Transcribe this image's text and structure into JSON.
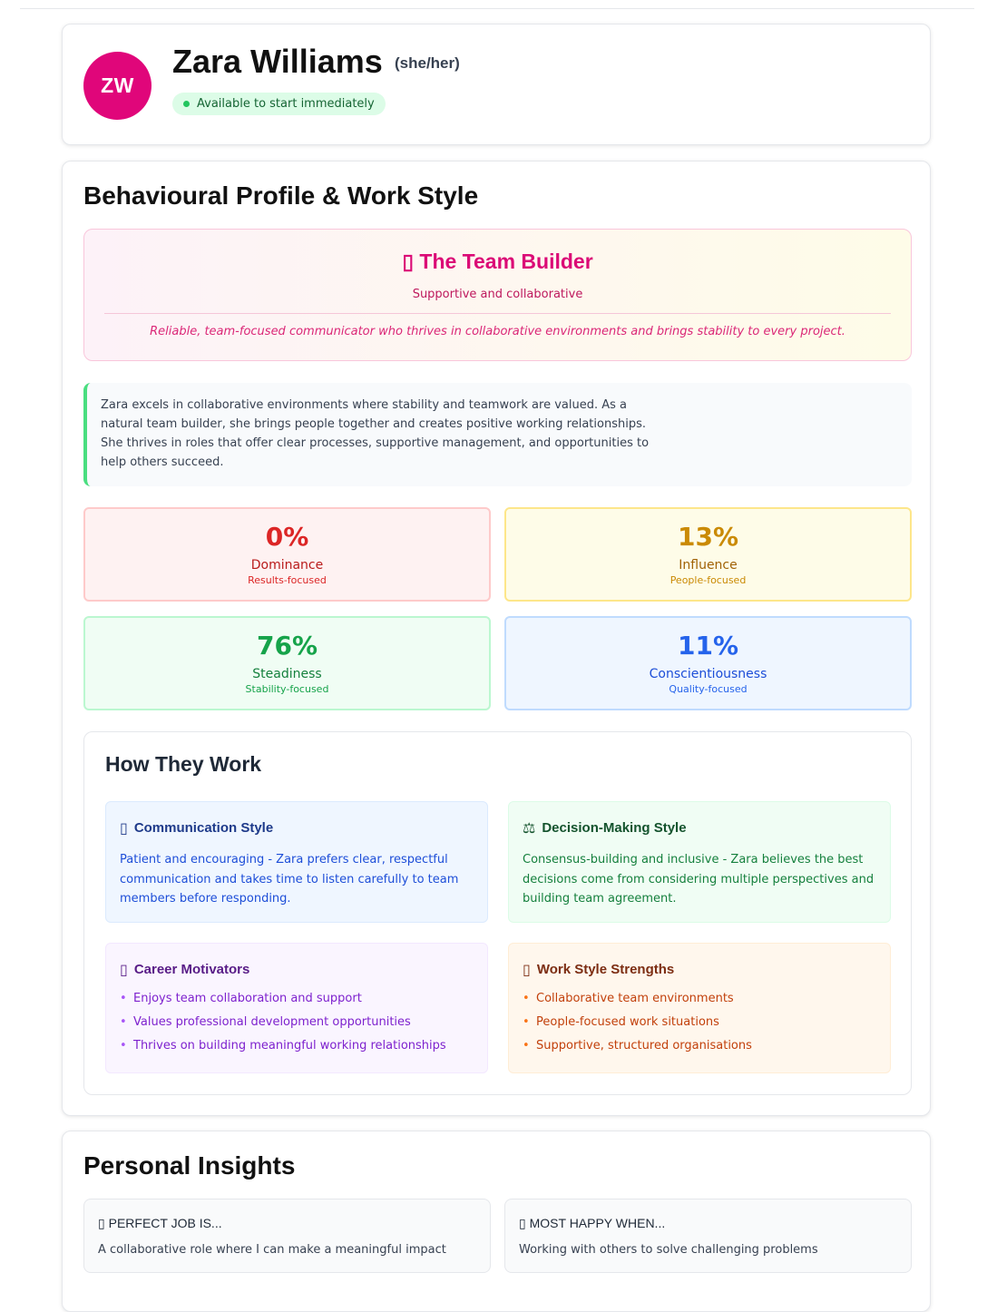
{
  "header": {
    "initials": "ZW",
    "name": "Zara Williams",
    "pronouns": "(she/her)",
    "availability": "Available to start immediately"
  },
  "behaviour": {
    "title": "Behavioural Profile & Work Style",
    "type": {
      "icon": "missing-glyph-icon",
      "icon_glyph": "▯",
      "title": "The Team Builder",
      "subtitle": "Supportive and collaborative",
      "description": "Reliable, team-focused communicator who thrives in collaborative environments and brings stability to every project."
    },
    "summary": "Zara excels in collaborative environments where stability and teamwork are valued. As a natural team builder, she brings people together and creates positive working relationships. She thrives in roles that offer clear processes, supportive management, and opportunities to help others succeed.",
    "disc": [
      {
        "percent": "0%",
        "label": "Dominance",
        "sub": "Results-focused",
        "color": "#dc2626"
      },
      {
        "percent": "13%",
        "label": "Influence",
        "sub": "People-focused",
        "color": "#ca8a04"
      },
      {
        "percent": "76%",
        "label": "Steadiness",
        "sub": "Stability-focused",
        "color": "#16a34a"
      },
      {
        "percent": "11%",
        "label": "Conscientiousness",
        "sub": "Quality-focused",
        "color": "#2563eb"
      }
    ],
    "how_they_work": {
      "title": "How They Work",
      "communication": {
        "icon": "missing-glyph-icon",
        "glyph": "▯",
        "title": "Communication Style",
        "text": "Patient and encouraging - Zara prefers clear, respectful communication and takes time to listen carefully to team members before responding."
      },
      "decision": {
        "icon": "scales-icon",
        "glyph": "⚖",
        "title": "Decision-Making Style",
        "text": "Consensus-building and inclusive - Zara believes the best decisions come from considering multiple perspectives and building team agreement."
      },
      "motivators": {
        "icon": "missing-glyph-icon",
        "glyph": "▯",
        "title": "Career Motivators",
        "items": [
          "Enjoys team collaboration and support",
          "Values professional development opportunities",
          "Thrives on building meaningful working relationships"
        ]
      },
      "strengths": {
        "icon": "missing-glyph-icon",
        "glyph": "▯",
        "title": "Work Style Strengths",
        "items": [
          "Collaborative team environments",
          "People-focused work situations",
          "Supportive, structured organisations"
        ]
      }
    }
  },
  "insights": {
    "title": "Personal Insights",
    "cards": [
      {
        "glyph": "▯",
        "question": "PERFECT JOB IS...",
        "answer": "A collaborative role where I can make a meaningful impact"
      },
      {
        "glyph": "▯",
        "question": "MOST HAPPY WHEN...",
        "answer": "Working with others to solve challenging problems"
      }
    ]
  },
  "bullet": "•"
}
